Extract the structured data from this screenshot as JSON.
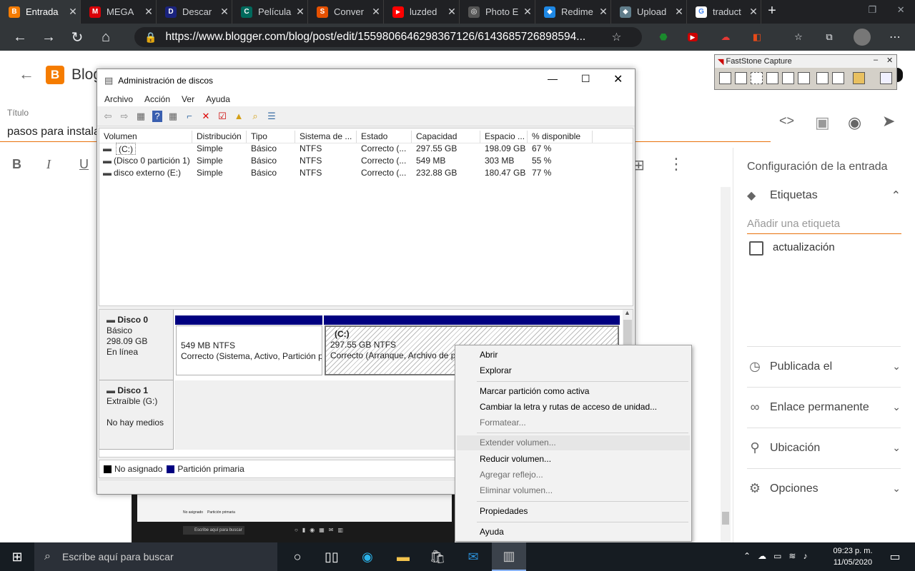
{
  "browser": {
    "tabs": [
      {
        "label": "Entrada",
        "color": "#f57c00",
        "glyph": "B"
      },
      {
        "label": "MEGA",
        "color": "#d90007",
        "glyph": "M"
      },
      {
        "label": "Descar",
        "color": "#1a237e",
        "glyph": "D"
      },
      {
        "label": "Película",
        "color": "#00695c",
        "glyph": "C"
      },
      {
        "label": "Conver",
        "color": "#e65100",
        "glyph": "S"
      },
      {
        "label": "luzded",
        "color": "#ff0000",
        "glyph": "▶"
      },
      {
        "label": "Photo E",
        "color": "#555555",
        "glyph": "◎"
      },
      {
        "label": "Redime",
        "color": "#1e88e5",
        "glyph": "◆"
      },
      {
        "label": "Upload",
        "color": "#607d8b",
        "glyph": "◆"
      },
      {
        "label": "traduct",
        "color": "#ffffff",
        "glyph": "G"
      }
    ],
    "new_tab": "+",
    "url": "https://www.blogger.com/blog/post/edit/1559806646298367126/6143685726898594..."
  },
  "blogger": {
    "app_title": "Blog",
    "title_label": "Título",
    "title_value": "pasos para instala",
    "fmt": {
      "bold": "B",
      "italic": "I",
      "underline": "U"
    },
    "settings_heading": "Configuración de la entrada",
    "labels_heading": "Etiquetas",
    "labels_placeholder": "Añadir una etiqueta",
    "label_option": "actualización",
    "panels": [
      "Publicada el",
      "Enlace permanente",
      "Ubicación",
      "Opciones"
    ]
  },
  "faststone": {
    "title": "FastStone Capture"
  },
  "diskmgmt": {
    "title": "Administración de discos",
    "menu": [
      "Archivo",
      "Acción",
      "Ver",
      "Ayuda"
    ],
    "columns": [
      "Volumen",
      "Distribución",
      "Tipo",
      "Sistema de ...",
      "Estado",
      "Capacidad",
      "Espacio ...",
      "% disponible"
    ],
    "rows": [
      [
        "(C:)",
        "Simple",
        "Básico",
        "NTFS",
        "Correcto (...",
        "297.55 GB",
        "198.09 GB",
        "67 %"
      ],
      [
        "(Disco 0 partición 1)",
        "Simple",
        "Básico",
        "NTFS",
        "Correcto (...",
        "549 MB",
        "303 MB",
        "55 %"
      ],
      [
        "disco externo (E:)",
        "Simple",
        "Básico",
        "NTFS",
        "Correcto (...",
        "232.88 GB",
        "180.47 GB",
        "77 %"
      ]
    ],
    "disk0": {
      "name": "Disco 0",
      "type": "Básico",
      "size": "298.09 GB",
      "status": "En línea",
      "p1_size": "549 MB NTFS",
      "p1_status": "Correcto (Sistema, Activo, Partición p",
      "p2_name": "(C:)",
      "p2_size": "297.55 GB NTFS",
      "p2_status": "Correcto (Arranque, Archivo de pa"
    },
    "disk1": {
      "name": "Disco 1",
      "type": "Extraíble (G:)",
      "media": "No hay medios"
    },
    "legend": [
      "No asignado",
      "Partición primaria"
    ]
  },
  "context_menu": {
    "items": [
      "Abrir",
      "Explorar",
      "Marcar partición como activa",
      "Cambiar la letra y rutas de acceso de unidad...",
      "Formatear...",
      "Extender volumen...",
      "Reducir volumen...",
      "Agregar reflejo...",
      "Eliminar volumen...",
      "Propiedades",
      "Ayuda"
    ]
  },
  "taskbar": {
    "search_placeholder": "Escribe aquí para buscar",
    "time": "09:23 p. m.",
    "date": "11/05/2020",
    "thumb_search": "Escribe aquí para buscar",
    "thumb_legend_1": "No asignado",
    "thumb_legend_2": "Partición primaria"
  },
  "colors": {
    "accent": "#e8710a",
    "primary_partition": "#000080"
  }
}
